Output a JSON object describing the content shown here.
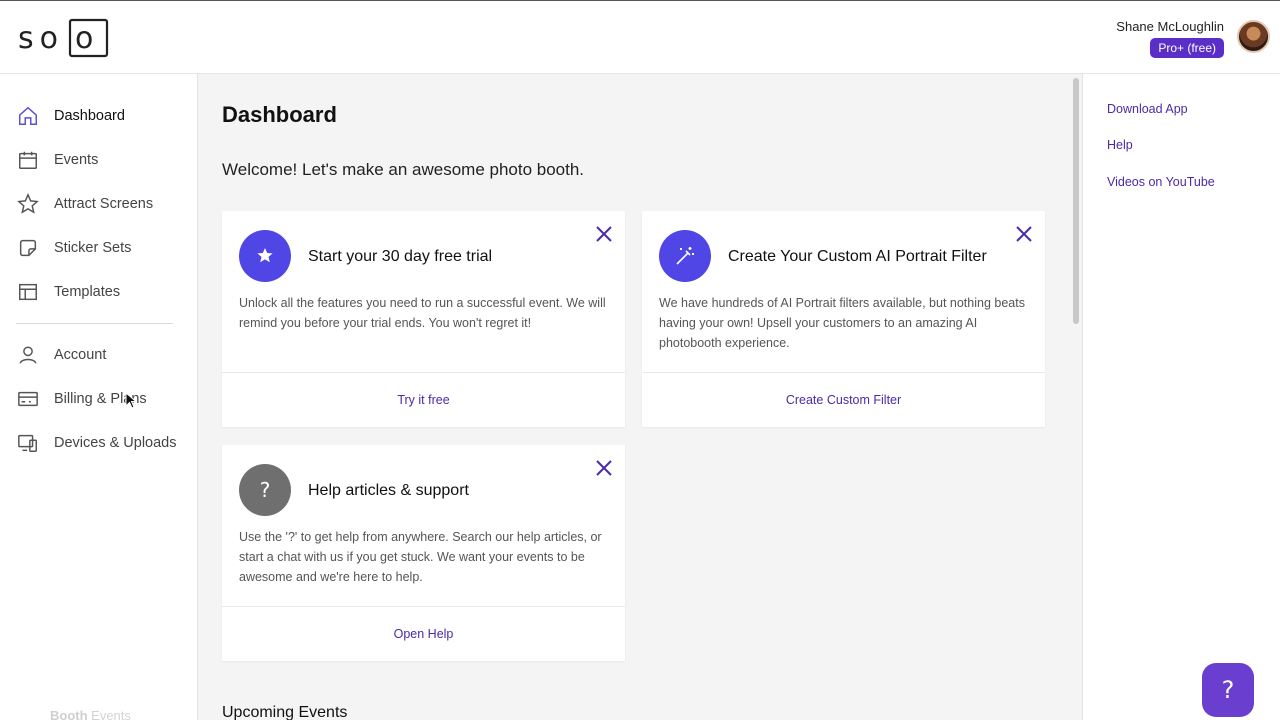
{
  "header": {
    "user_name": "Shane McLoughlin",
    "plan_badge": "Pro+ (free)"
  },
  "sidebar": {
    "items": [
      {
        "label": "Dashboard",
        "icon": "home-icon"
      },
      {
        "label": "Events",
        "icon": "calendar-icon"
      },
      {
        "label": "Attract Screens",
        "icon": "star-icon"
      },
      {
        "label": "Sticker Sets",
        "icon": "sticker-icon"
      },
      {
        "label": "Templates",
        "icon": "template-icon"
      },
      {
        "label": "Account",
        "icon": "user-icon"
      },
      {
        "label": "Billing & Plans",
        "icon": "card-icon"
      },
      {
        "label": "Devices & Uploads",
        "icon": "devices-icon"
      }
    ],
    "footer_bold": "Booth",
    "footer_rest": " Events"
  },
  "main": {
    "title": "Dashboard",
    "welcome": "Welcome! Let's make an awesome photo booth.",
    "cards": [
      {
        "title": "Start your 30 day free trial",
        "body": "Unlock all the features you need to run a successful event. We will remind you before your trial ends. You won't regret it!",
        "action": "Try it free",
        "icon": "star-icon"
      },
      {
        "title": "Create Your Custom AI Portrait Filter",
        "body": "We have hundreds of AI Portrait filters available, but nothing beats having your own! Upsell your customers to an amazing AI photobooth experience.",
        "action": "Create Custom Filter",
        "icon": "magic-wand-icon"
      },
      {
        "title": "Help articles & support",
        "body": "Use the '?' to get help from anywhere. Search our help articles, or start a chat with us if you get stuck. We want your events to be awesome and we're here to help.",
        "action": "Open Help",
        "icon": "question-icon"
      }
    ],
    "upcoming_title": "Upcoming Events"
  },
  "right_panel": {
    "links": [
      "Download App",
      "Help",
      "Videos on YouTube"
    ]
  },
  "help_fab": {
    "label": "?"
  },
  "colors": {
    "accent": "#4f46e5",
    "link": "#4b2aa8",
    "badge": "#5b2fc7"
  }
}
